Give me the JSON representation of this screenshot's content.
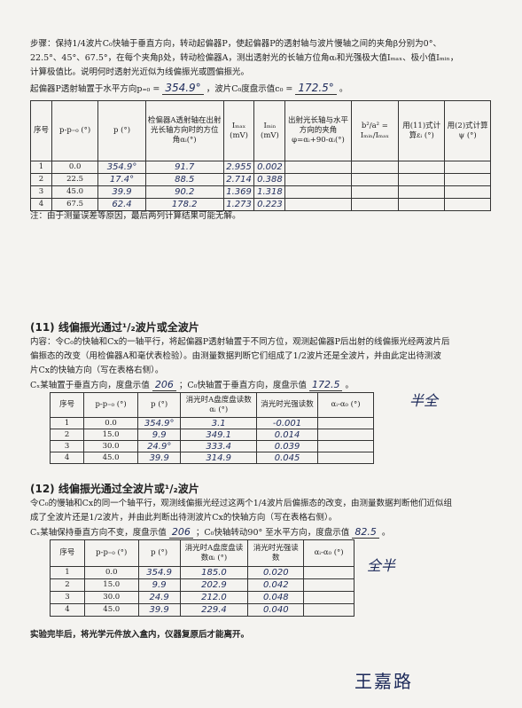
{
  "steps": {
    "line1": "步骤：保持1/4波片C₀快轴于垂直方向，转动起偏器P，使起偏器P的透射轴与波片慢轴之间的夹角β分别为0°、",
    "line2": "22.5°、45°、67.5°，在每个夹角β处，转动检偏器A，测出透射光的长轴方位角αᵢ和光强极大值Iₘₐₓ、极小值Iₘᵢₙ，",
    "line3": "计算极值比。说明何时透射光近似为线偏振光或圆偏振光。",
    "line4_prefix": "起偏器P透射轴置于水平方向p₌₀ =",
    "p_horizontal": "354.9°",
    "line4_mid": "，波片C₀度盘示值c₀ =",
    "c0_value": "172.5°",
    "line4_suffix": "。"
  },
  "table1": {
    "headers": [
      "序号",
      "p-p₌₀ (°)",
      "p (°)",
      "检偏器A透射轴在出射光长轴方向时的方位角αᵢ(°)",
      "Iₘₐₓ (mV)",
      "Iₘᵢₙ (mV)",
      "出射光长轴与水平方向的夹角 φ=αᵢ+90-αᵢ(°)",
      "b²/a² = Iₘᵢₙ/Iₘₐₓ",
      "用(11)式计算εᵢ (°)",
      "用(2)式计算ψ (°)"
    ],
    "rows": [
      [
        "1",
        "0.0",
        "354.9°",
        "91.7",
        "2.955",
        "0.002",
        "",
        "",
        "",
        ""
      ],
      [
        "2",
        "22.5",
        "17.4°",
        "88.5",
        "2.714",
        "0.388",
        "",
        "",
        "",
        ""
      ],
      [
        "3",
        "45.0",
        "39.9",
        "90.2",
        "1.369",
        "1.318",
        "",
        "",
        "",
        ""
      ],
      [
        "4",
        "67.5",
        "62.4",
        "178.2",
        "1.273",
        "0.223",
        "",
        "",
        "",
        ""
      ]
    ]
  },
  "note1": "注：由于测量误差等原因，最后两列计算结果可能无解。",
  "section11": {
    "title": "(11) 线偏振光通过¹/₂波片或全波片",
    "line1": "内容：令C₀的快轴和Cx的一轴平行，将起偏器P透射轴置于不同方位，观测起偏器P后出射的线偏振光经两波片后",
    "line2": "偏振态的改变（用检偏器A和毫伏表检验）。由测量数据判断它们组成了1/2波片还是全波片，并由此定出待测波",
    "line3": "片Cx的快轴方向（写在表格右侧）。",
    "line4_prefix": "Cₓ某轴置于垂直方向，度盘示值",
    "cx_value": "206",
    "line4_mid": "；C₀快轴置于垂直方向，度盘示值",
    "c0_value": "172.5",
    "line4_suffix": "。",
    "side_note": "半全",
    "headers": [
      "序号",
      "p-p₌₀ (°)",
      "p (°)",
      "消光时A盘度盘读数αᵢ (°)",
      "消光时光强读数",
      "αᵢ-α₀ (°)"
    ],
    "rows": [
      [
        "1",
        "0.0",
        "354.9°",
        "3.1",
        "-0.001",
        ""
      ],
      [
        "2",
        "15.0",
        "9.9",
        "349.1",
        "0.014",
        ""
      ],
      [
        "3",
        "30.0",
        "24.9°",
        "333.4",
        "0.039",
        ""
      ],
      [
        "4",
        "45.0",
        "39.9",
        "314.9",
        "0.045",
        ""
      ]
    ]
  },
  "section12": {
    "title": "(12) 线偏振光通过全波片或¹/₂波片",
    "line1": "令C₀的慢轴和Cx的同一个轴平行，观测线偏振光经过这两个1/4波片后偏振态的改变，由测量数据判断他们近似组",
    "line2": "成了全波片还是1/2波片，并由此判断出待测波片Cx的快轴方向（写在表格右侧）。",
    "line3_prefix": "Cₓ某轴保持垂直方向不变，度盘示值",
    "cx_value": "206",
    "line3_mid": "；C₀快轴转动90° 至水平方向，度盘示值",
    "c0_value": "82.5",
    "line3_suffix": "。",
    "side_note": "全半",
    "headers": [
      "序号",
      "p-p₌₀ (°)",
      "p (°)",
      "消光时A盘度盘读数αᵢ (°)",
      "消光时光强读数",
      "αᵢ-α₀ (°)"
    ],
    "rows": [
      [
        "1",
        "0.0",
        "354.9",
        "185.0",
        "0.020",
        ""
      ],
      [
        "2",
        "15.0",
        "9.9",
        "202.9",
        "0.042",
        ""
      ],
      [
        "3",
        "30.0",
        "24.9",
        "212.0",
        "0.048",
        ""
      ],
      [
        "4",
        "45.0",
        "39.9",
        "229.4",
        "0.040",
        ""
      ]
    ]
  },
  "footer": "实验完毕后，将光学元件放入盒内，仪器复原后才能离开。",
  "signature": "王嘉路"
}
